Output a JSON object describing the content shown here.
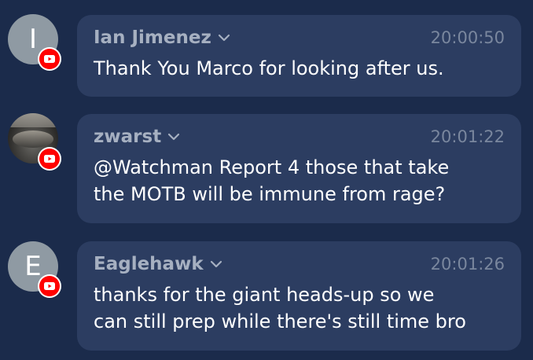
{
  "messages": [
    {
      "author": "Ian Jimenez",
      "time": "20:00:50",
      "text": "Thank You Marco for looking after us.",
      "avatar_initial": "I",
      "platform_icon": "youtube-icon"
    },
    {
      "author": "zwarst",
      "time": "20:01:22",
      "text": "@Watchman Report 4 those that take\nthe MOTB will be immune from rage?",
      "avatar_initial": "",
      "platform_icon": "youtube-icon"
    },
    {
      "author": "Eaglehawk",
      "time": "20:01:26",
      "text": "thanks for the giant heads-up so we\ncan still prep while there's still time bro",
      "avatar_initial": "E",
      "platform_icon": "youtube-icon"
    }
  ],
  "colors": {
    "background": "#1b2b4b",
    "bubble": "#2c3d61",
    "author": "#a6b0c1",
    "timestamp": "#7a879e",
    "message_text": "#ffffff",
    "avatar": "#8f9aa3",
    "youtube": "#ff0000"
  }
}
